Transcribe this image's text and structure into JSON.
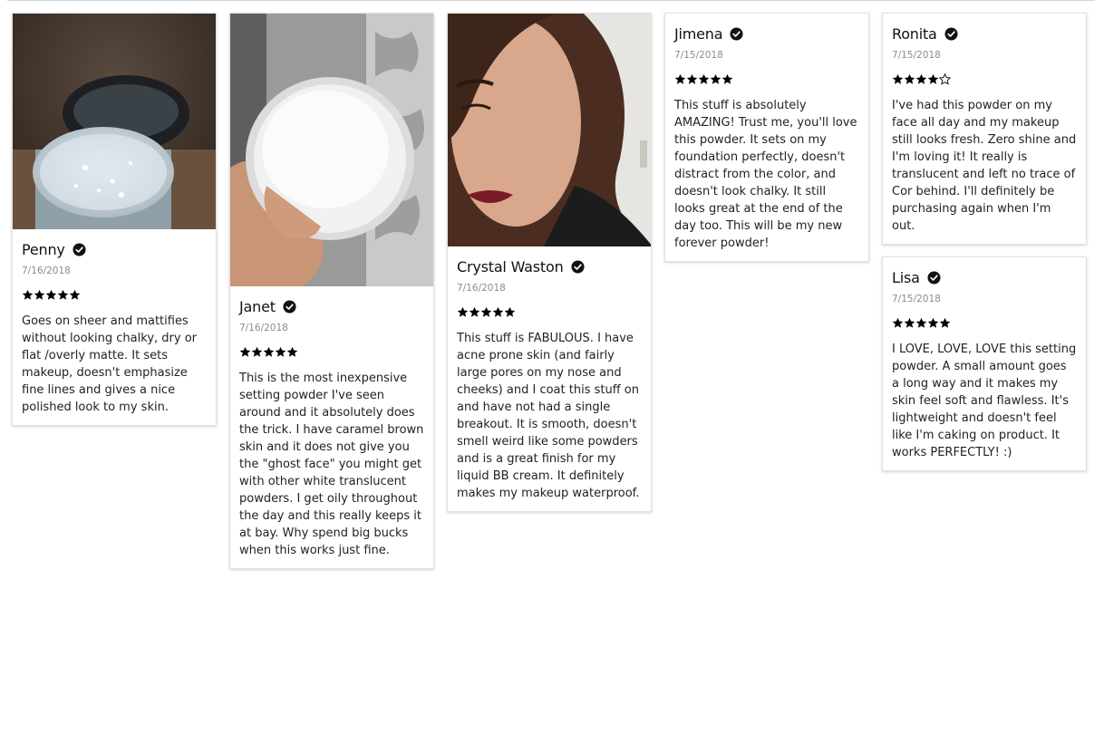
{
  "reviews": [
    {
      "name": "Penny",
      "date": "7/16/2018",
      "rating": 5,
      "text": "Goes on sheer and mattifies without looking chalky, dry or flat /overly matte. It sets makeup, doesn't emphasize fine lines and gives a nice polished look to my skin.",
      "photo": "powder-jar-photo"
    },
    {
      "name": "Janet",
      "date": "7/16/2018",
      "rating": 5,
      "text": "This is the most inexpensive setting powder I've seen around and it absolutely does the trick. I have caramel brown skin and it does not give you the \"ghost face\" you might get with other white translucent powders. I get oily throughout the day and this really keeps it at bay. Why spend big bucks when this works just fine.",
      "photo": "powder-in-hand-photo"
    },
    {
      "name": "Crystal Waston",
      "date": "7/16/2018",
      "rating": 5,
      "text": "This stuff is FABULOUS. I have acne prone skin (and fairly large pores on my nose and cheeks) and I coat this stuff on and have not had a single breakout. It is smooth, doesn't smell weird like some powders and is a great finish for my liquid BB cream. It definitely makes my makeup waterproof.",
      "photo": "selfie-photo"
    },
    {
      "name": "Jimena",
      "date": "7/15/2018",
      "rating": 5,
      "text": "This stuff is absolutely AMAZING! Trust me, you'll love this powder. It sets on my foundation perfectly, doesn't distract from the color, and doesn't look chalky. It still looks great at the end of the day too. This will be my new forever powder!"
    },
    {
      "name": "Ronita",
      "date": "7/15/2018",
      "rating": 4,
      "text": "I've had this powder on my face all day and my makeup still looks fresh. Zero shine and I'm loving it! It really is translucent and left no trace of Cor behind. I'll definitely be purchasing again when I'm out."
    },
    {
      "name": "Lisa",
      "date": "7/15/2018",
      "rating": 5,
      "text": "I LOVE, LOVE, LOVE this setting powder. A small amount goes a long way and it makes my skin feel soft and flawless. It's lightweight and doesn't feel like I'm caking on product. It works PERFECTLY! :)"
    }
  ],
  "icons": {
    "verified": "verified-check-icon",
    "star": "star-icon"
  },
  "colors": {
    "text": "#222222",
    "date": "#8c8c8c",
    "star": "#000000"
  }
}
